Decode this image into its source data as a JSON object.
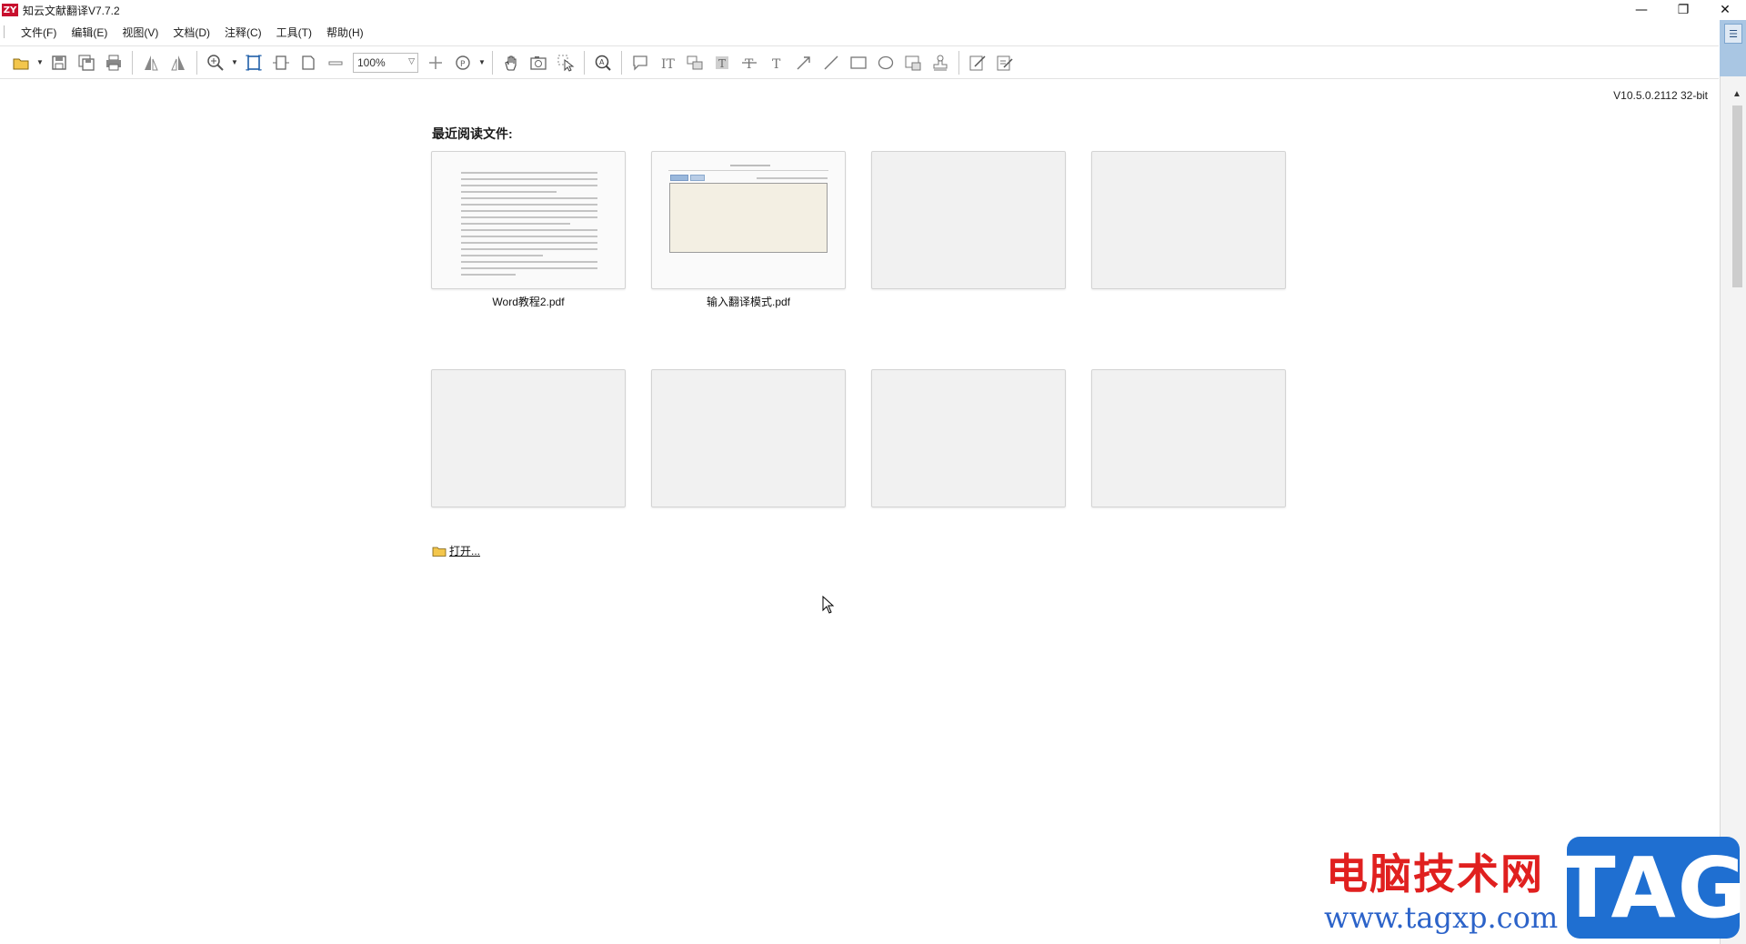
{
  "window": {
    "logo": "ZY",
    "title": "知云文献翻译V7.7.2",
    "controls": {
      "minimize": "—",
      "restore": "❐",
      "close": "✕"
    }
  },
  "menu": {
    "items": [
      "文件(F)",
      "编辑(E)",
      "视图(V)",
      "文档(D)",
      "注释(C)",
      "工具(T)",
      "帮助(H)"
    ]
  },
  "toolbar": {
    "zoom_value": "100%",
    "icons": [
      "open-folder-icon",
      "save-icon",
      "save-all-icon",
      "print-icon",
      "rotate-left-icon",
      "rotate-right-icon",
      "zoom-in-icon",
      "fit-page-icon",
      "fit-width-icon",
      "actual-size-icon",
      "zoom-out-icon",
      "zoom-plus-icon",
      "page-navigation-icon",
      "hand-tool-icon",
      "snapshot-icon",
      "select-tool-icon",
      "search-icon",
      "comment-icon",
      "text-select-icon",
      "translate-icon",
      "highlight-icon",
      "strikethrough-icon",
      "typewriter-icon",
      "arrow-icon",
      "line-icon",
      "rectangle-icon",
      "ellipse-icon",
      "image-annotation-icon",
      "stamp-icon",
      "edit-note-icon",
      "edit-doc-icon"
    ]
  },
  "version": "V10.5.0.2112 32-bit",
  "recent": {
    "heading": "最近阅读文件:",
    "files": [
      {
        "name": "Word教程2.pdf"
      },
      {
        "name": "输入翻译模式.pdf"
      },
      {
        "name": ""
      },
      {
        "name": ""
      },
      {
        "name": ""
      },
      {
        "name": ""
      },
      {
        "name": ""
      },
      {
        "name": ""
      }
    ],
    "open_label": "打开..."
  },
  "watermark": {
    "text": "电脑技术网",
    "url": "www.tagxp.com",
    "badge": "TAG"
  },
  "colors": {
    "accent_panel": "#a9c6e3",
    "watermark_red": "#e0201f",
    "watermark_blue": "#1f6fd1"
  }
}
